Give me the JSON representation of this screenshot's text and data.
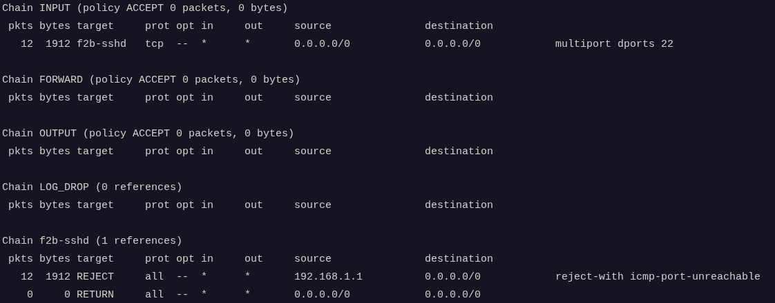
{
  "chains": [
    {
      "header": "Chain INPUT (policy ACCEPT 0 packets, 0 bytes)",
      "columns": [
        "pkts",
        "bytes",
        "target",
        "prot",
        "opt",
        "in",
        "out",
        "source",
        "destination"
      ],
      "rows": [
        {
          "cells": [
            "12",
            "1912",
            "f2b-sshd",
            "tcp",
            "--",
            "*",
            "*",
            "0.0.0.0/0",
            "0.0.0.0/0",
            "multiport dports 22"
          ]
        }
      ]
    },
    {
      "header": "Chain FORWARD (policy ACCEPT 0 packets, 0 bytes)",
      "columns": [
        "pkts",
        "bytes",
        "target",
        "prot",
        "opt",
        "in",
        "out",
        "source",
        "destination"
      ]
    },
    {
      "header": "Chain OUTPUT (policy ACCEPT 0 packets, 0 bytes)",
      "columns": [
        "pkts",
        "bytes",
        "target",
        "prot",
        "opt",
        "in",
        "out",
        "source",
        "destination"
      ]
    },
    {
      "header": "Chain LOG_DROP (0 references)",
      "columns": [
        "pkts",
        "bytes",
        "target",
        "prot",
        "opt",
        "in",
        "out",
        "source",
        "destination"
      ]
    },
    {
      "header": "Chain f2b-sshd (1 references)",
      "columns": [
        "pkts",
        "bytes",
        "target",
        "prot",
        "opt",
        "in",
        "out",
        "source",
        "destination"
      ],
      "rows": [
        {
          "cells": [
            "12",
            "1912",
            "REJECT",
            "all",
            "--",
            "*",
            "*",
            "192.168.1.1",
            "0.0.0.0/0",
            "reject-with icmp-port-unreachable"
          ]
        },
        {
          "cells": [
            "0",
            "0",
            "RETURN",
            "all",
            "--",
            "*",
            "*",
            "0.0.0.0/0",
            "0.0.0.0/0"
          ]
        }
      ]
    }
  ]
}
